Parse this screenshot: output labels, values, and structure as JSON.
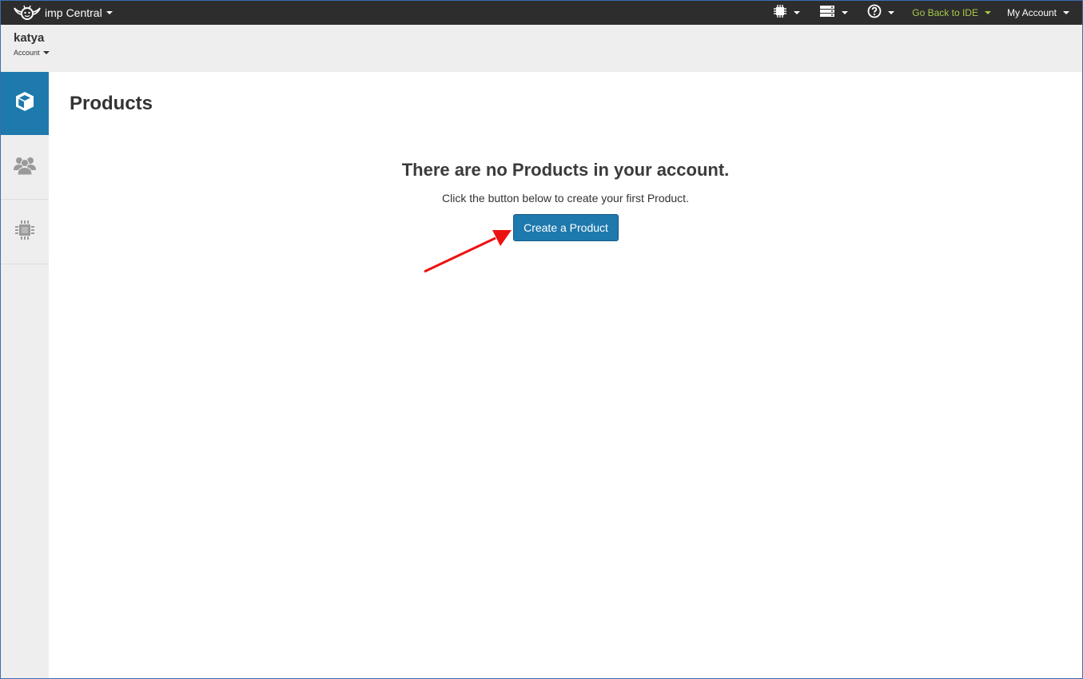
{
  "topbar": {
    "brand_imp": "imp",
    "brand_central": "Central",
    "icons": [
      "chip-icon",
      "server-icon",
      "help-icon"
    ],
    "ide_link": "Go Back to IDE",
    "account_link": "My Account",
    "colors": {
      "bar": "#2d2d2d",
      "ide": "#a8c94a"
    }
  },
  "account": {
    "name": "katya",
    "sub_label": "Account"
  },
  "sidebar": {
    "items": [
      {
        "icon": "cube-icon",
        "active": true
      },
      {
        "icon": "users-icon",
        "active": false
      },
      {
        "icon": "chip-icon",
        "active": false
      }
    ],
    "active_color": "#1e79ad"
  },
  "main": {
    "title": "Products",
    "empty_title": "There are no Products in your account.",
    "empty_text": "Click the button below to create your first Product.",
    "create_button": "Create a Product",
    "button_color": "#1e79ad",
    "annotation_color": "#ee1111"
  }
}
